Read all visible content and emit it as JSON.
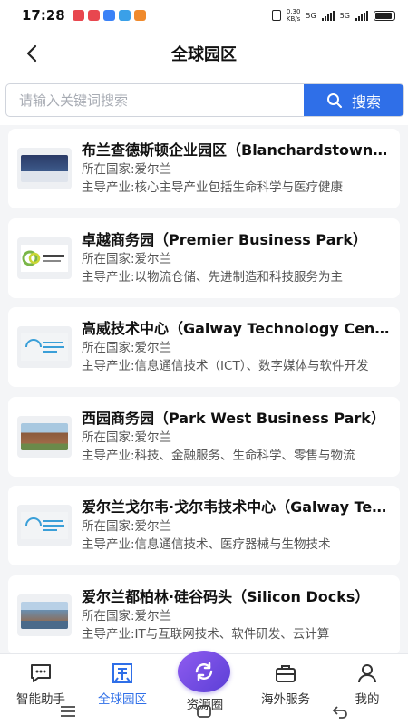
{
  "status_bar": {
    "time": "17:28",
    "net_speed_value": "0.30",
    "net_speed_unit": "KB/s",
    "sim1": "5G",
    "sim2": "5G",
    "app_icon_colors": [
      "#e8474f",
      "#e8474f",
      "#3a82f7",
      "#3aa0e8",
      "#f08a2c"
    ]
  },
  "header": {
    "title": "全球园区",
    "back_icon": "chevron-left-icon"
  },
  "search": {
    "placeholder": "请输入关键词搜索",
    "value": "",
    "button_label": "搜索"
  },
  "parks": [
    {
      "name": "布兰查德斯顿企业园区（Blanchardstown Corporate Park）",
      "country": "所在国家:爱尔兰",
      "industry": "主导产业:核心主导产业包括生命科学与医疗健康",
      "thumb_color": "#2a3a66"
    },
    {
      "name": "卓越商务园（Premier Business Park）",
      "country": "所在国家:爱尔兰",
      "industry": "主导产业:以物流仓储、先进制造和科技服务为主",
      "thumb_color": "#7ab648"
    },
    {
      "name": "高威技术中心（Galway Technology Centre）",
      "country": "所在国家:爱尔兰",
      "industry": "主导产业:信息通信技术（ICT）、数字媒体与软件开发",
      "thumb_color": "#3a9fd8"
    },
    {
      "name": "西园商务园（Park West Business Park）",
      "country": "所在国家:爱尔兰",
      "industry": "主导产业:科技、金融服务、生命科学、零售与物流",
      "thumb_color": "#8a5a3c"
    },
    {
      "name": "爱尔兰戈尔韦·戈尔韦技术中心（Galway Technology Centre）",
      "country": "所在国家:爱尔兰",
      "industry": "主导产业:信息通信技术、医疗器械与生物技术",
      "thumb_color": "#3a9fd8"
    },
    {
      "name": "爱尔兰都柏林·硅谷码头（Silicon Docks）",
      "country": "所在国家:爱尔兰",
      "industry": "主导产业:IT与互联网技术、软件研发、云计算",
      "thumb_color": "#6a8fb0"
    }
  ],
  "bottom_nav": {
    "items": [
      {
        "label": "智能助手",
        "icon": "chat-icon"
      },
      {
        "label": "全球园区",
        "icon": "park-icon",
        "active": true
      },
      {
        "label": "资源圈",
        "icon": "refresh-icon"
      },
      {
        "label": "海外服务",
        "icon": "briefcase-icon"
      },
      {
        "label": "我的",
        "icon": "user-icon"
      }
    ],
    "active_color": "#2f6fe8"
  }
}
